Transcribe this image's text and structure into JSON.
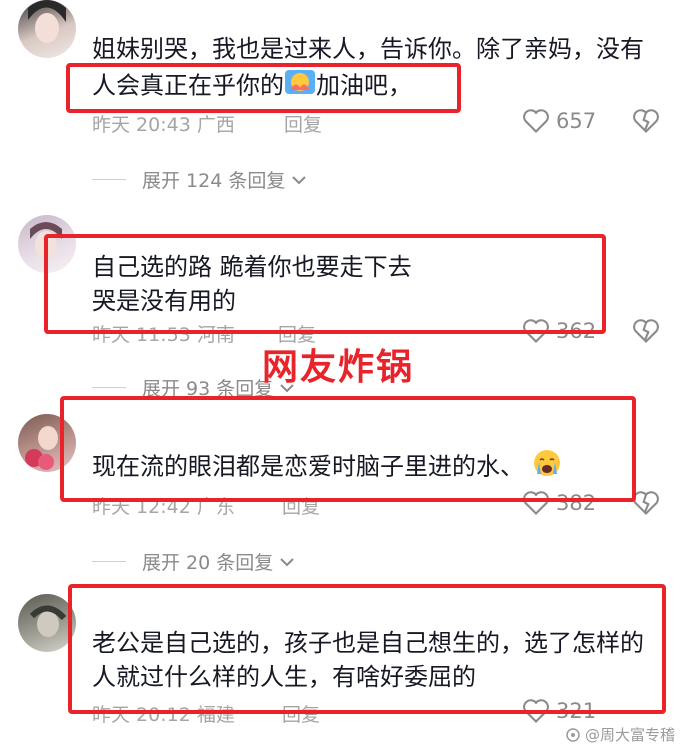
{
  "comments": [
    {
      "username": "",
      "text_lines": [
        "姐妹别哭，我也是过来人，告诉你。除了亲妈，没有",
        "人会真正在乎你的",
        "加油吧，"
      ],
      "time": "昨天 20:43",
      "location": "广西",
      "reply_label": "回复",
      "likes": "657",
      "expand_label": "展开 124 条回复"
    },
    {
      "username": "",
      "text_lines": [
        "自己选的路  跪着你也要走下去",
        "哭是没有用的"
      ],
      "time": "昨天 11:53",
      "location": "河南",
      "reply_label": "回复",
      "likes": "362",
      "expand_label": "展开 93 条回复"
    },
    {
      "username": "",
      "text_lines": [
        "现在流的眼泪都是恋爱时脑子里进的水、"
      ],
      "time": "昨天 12:42",
      "location": "广东",
      "reply_label": "回复",
      "likes": "382",
      "expand_label": "展开 20 条回复"
    },
    {
      "username": "",
      "text_lines": [
        "老公是自己选的，孩子也是自己想生的，选了怎样的",
        "人就过什么样的人生，有啥好委屈的"
      ],
      "time": "昨天 20:12",
      "location": "福建",
      "reply_label": "回复",
      "likes": "321"
    }
  ],
  "overlay_title": "网友炸锅",
  "watermark": "@周大富专稽",
  "colors": {
    "highlight_box": "#e8232a",
    "overlay_text": "#e8232a"
  },
  "icons": [
    "heart-icon",
    "broken-heart-icon",
    "chevron-down-icon",
    "hug-emoji",
    "crying-emoji"
  ]
}
